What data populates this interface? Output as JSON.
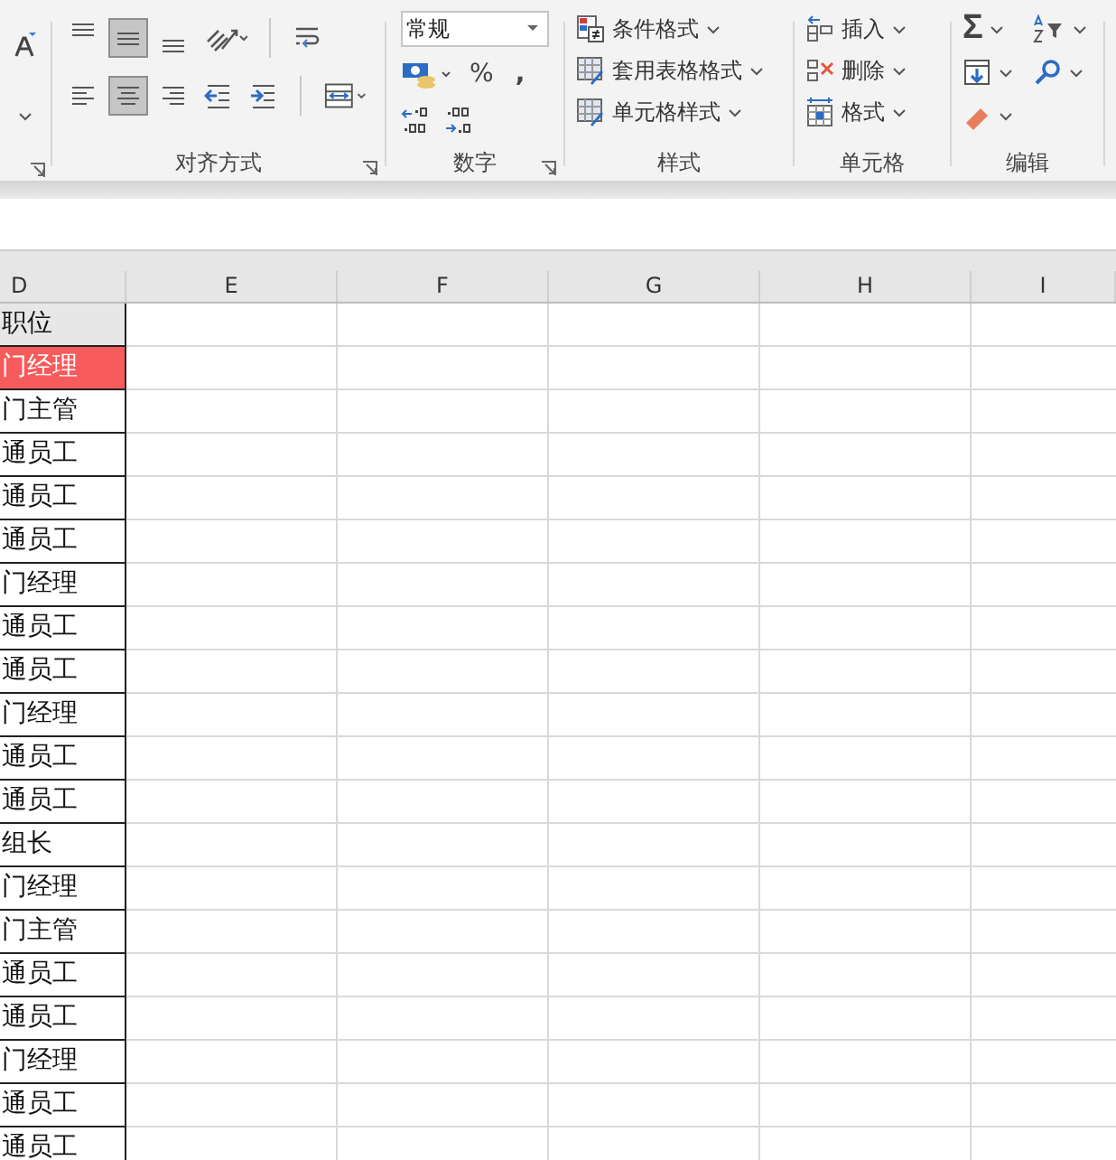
{
  "ribbon": {
    "alignment": {
      "label": "对齐方式",
      "buttons": [
        {
          "kind": "top",
          "selected": false
        },
        {
          "kind": "middle",
          "selected": true
        },
        {
          "kind": "bottom",
          "selected": false
        },
        {
          "kind": "orientation",
          "selected": false
        },
        {
          "kind": "left",
          "selected": false
        },
        {
          "kind": "center",
          "selected": true
        },
        {
          "kind": "right",
          "selected": false
        },
        {
          "kind": "outdent",
          "selected": false
        },
        {
          "kind": "indent",
          "selected": false
        }
      ]
    },
    "number": {
      "label": "数字",
      "format": "常规",
      "percent": "%",
      "comma": ","
    },
    "styles": {
      "label": "样式",
      "items": [
        "条件格式",
        "套用表格格式",
        "单元格样式"
      ]
    },
    "cells": {
      "label": "单元格",
      "items": [
        "插入",
        "删除",
        "格式"
      ]
    },
    "editing": {
      "label": "编辑",
      "sum": "Σ"
    }
  },
  "sheet": {
    "columns": [
      "D",
      "E",
      "F",
      "G",
      "H",
      "I"
    ],
    "rows": [
      {
        "text": "职位",
        "kind": "header",
        "highlighted": false
      },
      {
        "text": "门经理",
        "kind": "data",
        "highlighted": true
      },
      {
        "text": "门主管",
        "kind": "data",
        "highlighted": false
      },
      {
        "text": "通员工",
        "kind": "data",
        "highlighted": false
      },
      {
        "text": "通员工",
        "kind": "data",
        "highlighted": false
      },
      {
        "text": "通员工",
        "kind": "data",
        "highlighted": false
      },
      {
        "text": "门经理",
        "kind": "data",
        "highlighted": false
      },
      {
        "text": "通员工",
        "kind": "data",
        "highlighted": false
      },
      {
        "text": "通员工",
        "kind": "data",
        "highlighted": false
      },
      {
        "text": "门经理",
        "kind": "data",
        "highlighted": false
      },
      {
        "text": "通员工",
        "kind": "data",
        "highlighted": false
      },
      {
        "text": "通员工",
        "kind": "data",
        "highlighted": false
      },
      {
        "text": "组长",
        "kind": "data",
        "highlighted": false
      },
      {
        "text": "门经理",
        "kind": "data",
        "highlighted": false
      },
      {
        "text": "门主管",
        "kind": "data",
        "highlighted": false
      },
      {
        "text": "通员工",
        "kind": "data",
        "highlighted": false
      },
      {
        "text": "通员工",
        "kind": "data",
        "highlighted": false
      },
      {
        "text": "门经理",
        "kind": "data",
        "highlighted": false
      },
      {
        "text": "通员工",
        "kind": "data",
        "highlighted": false
      },
      {
        "text": "通员工",
        "kind": "data",
        "highlighted": false
      }
    ]
  }
}
